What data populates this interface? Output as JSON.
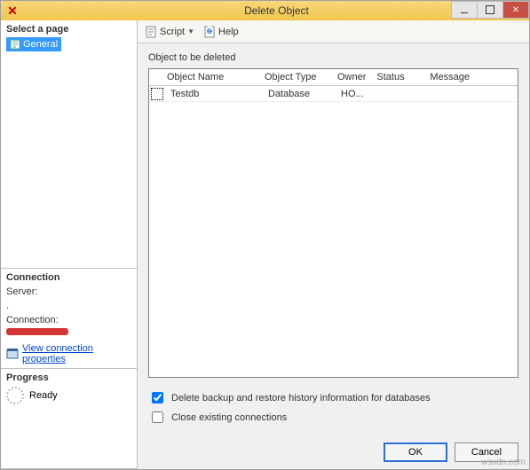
{
  "window": {
    "title": "Delete Object"
  },
  "sidebar": {
    "select_page": "Select a page",
    "general": "General",
    "connection_header": "Connection",
    "server_label": "Server:",
    "server_value": ".",
    "connection_label": "Connection:",
    "view_conn_props": "View connection properties",
    "progress_header": "Progress",
    "progress_status": "Ready"
  },
  "toolbar": {
    "script": "Script",
    "help": "Help"
  },
  "main": {
    "list_label": "Object to be deleted",
    "columns": {
      "name": "Object Name",
      "type": "Object Type",
      "owner": "Owner",
      "status": "Status",
      "message": "Message"
    },
    "row": {
      "name": "Testdb",
      "type": "Database",
      "owner": "HO...",
      "status": "",
      "message": ""
    },
    "chk_delete_backup": "Delete backup and restore history information for databases",
    "chk_close_conn": "Close existing connections"
  },
  "buttons": {
    "ok": "OK",
    "cancel": "Cancel"
  },
  "watermark": "wsxdn.com"
}
